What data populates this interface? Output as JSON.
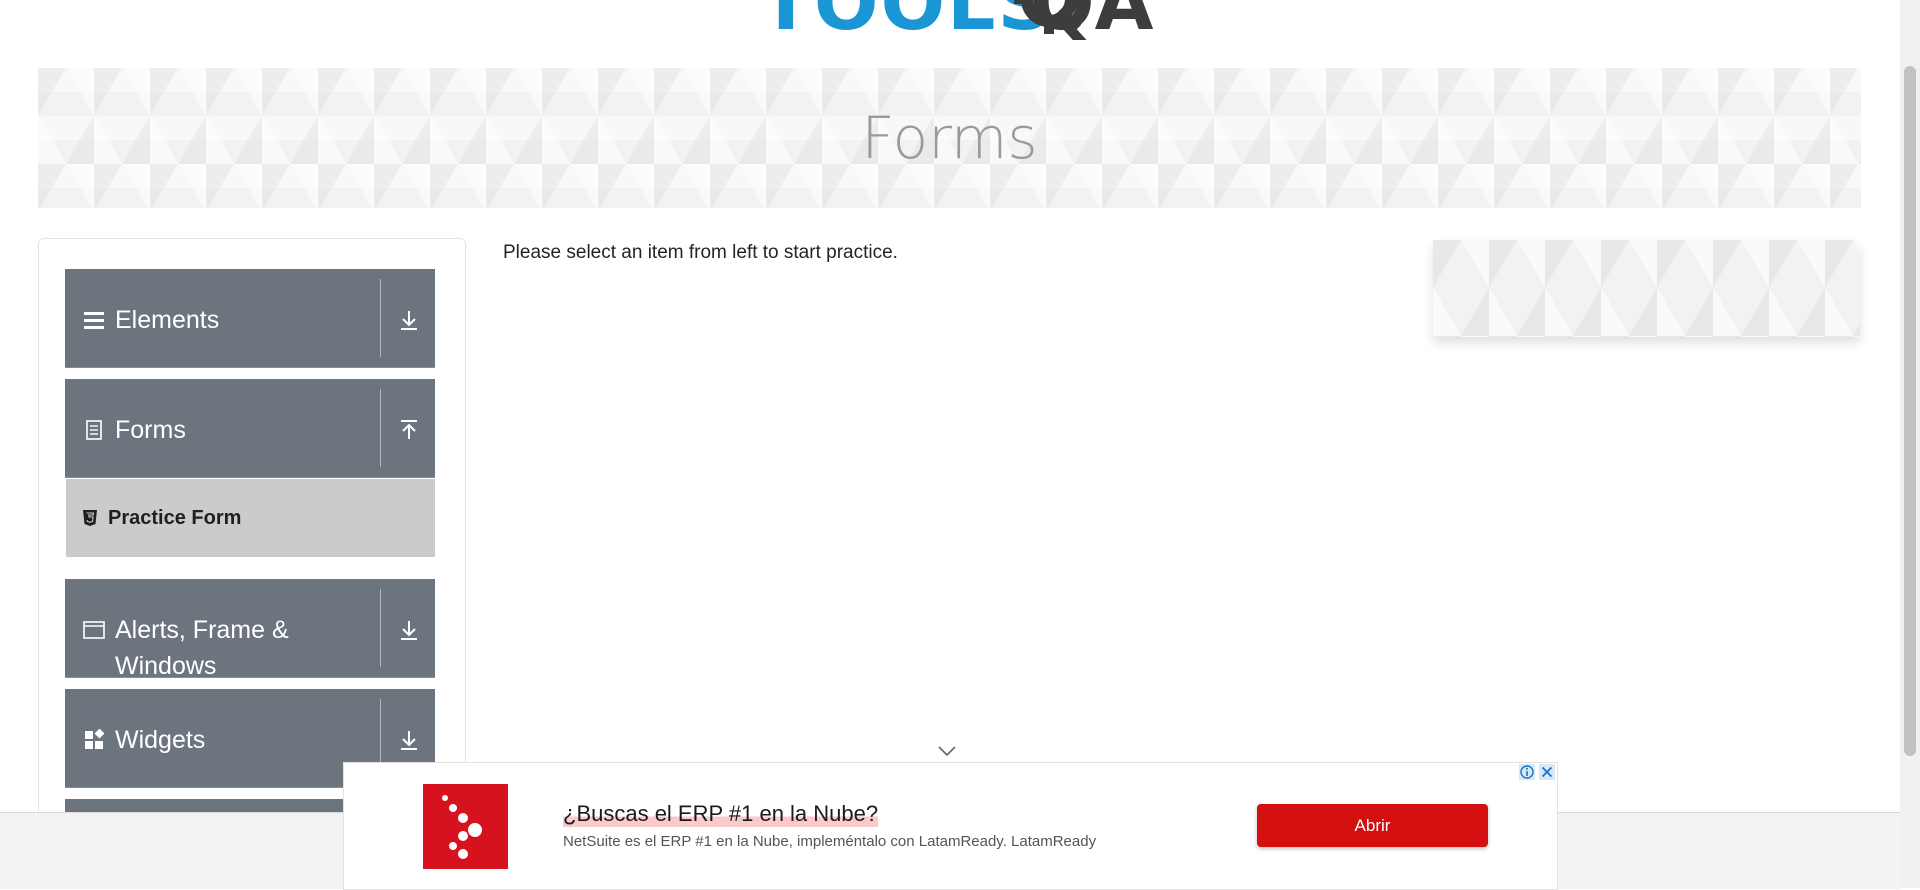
{
  "logo": {
    "text_tools": "TOOLS",
    "text_qa": "QA"
  },
  "banner": {
    "title": "Forms"
  },
  "sidebar": {
    "groups": [
      {
        "label": "Elements",
        "icon": "menu-icon",
        "toggle": "download-icon"
      },
      {
        "label": "Forms",
        "icon": "document-icon",
        "toggle": "upload-icon",
        "expanded": true,
        "items": [
          {
            "label": "Practice Form",
            "icon": "html5-icon"
          }
        ]
      },
      {
        "label": "Alerts, Frame & Windows",
        "icon": "window-icon",
        "toggle": "download-icon"
      },
      {
        "label": "Widgets",
        "icon": "widgets-icon",
        "toggle": "download-icon"
      }
    ]
  },
  "main": {
    "instructions": "Please select an item from left to start practice."
  },
  "ad": {
    "headline": "¿Buscas el ERP #1 en la Nube?",
    "subtext": "NetSuite es el ERP #1 en la Nube, impleméntalo con LatamReady. LatamReady",
    "cta": "Abrir",
    "brand_color": "#d6121e"
  },
  "colors": {
    "accent_blue": "#1a96d4",
    "sidebar_bg": "#6c757d",
    "submenu_active_bg": "#cbcbcb"
  }
}
